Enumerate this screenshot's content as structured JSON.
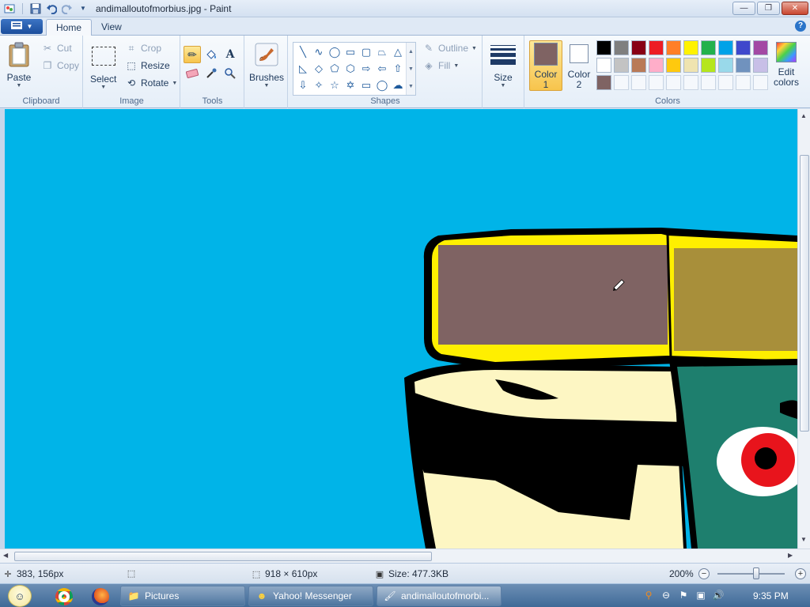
{
  "window": {
    "title": "andimalloutofmorbius.jpg - Paint",
    "minimize_glyph": "—",
    "restore_glyph": "❐",
    "close_glyph": "✕"
  },
  "ribbon_tabs": {
    "home": "Home",
    "view": "View",
    "help": "?"
  },
  "clipboard": {
    "paste": "Paste",
    "cut": "Cut",
    "copy": "Copy",
    "group_label": "Clipboard"
  },
  "image": {
    "select": "Select",
    "crop": "Crop",
    "resize": "Resize",
    "rotate": "Rotate",
    "group_label": "Image"
  },
  "tools": {
    "group_label": "Tools",
    "items": [
      "pencil-icon",
      "fill-icon",
      "text-icon",
      "eraser-icon",
      "color-picker-icon",
      "magnifier-icon"
    ],
    "text_glyph": "A"
  },
  "brushes": {
    "label": "Brushes"
  },
  "shapes": {
    "outline": "Outline",
    "fill": "Fill",
    "group_label": "Shapes"
  },
  "size": {
    "label": "Size"
  },
  "colors": {
    "color1_label": "Color 1",
    "color1_line1": "Color",
    "color1_line2": "1",
    "color2_line1": "Color",
    "color2_line2": "2",
    "edit_line1": "Edit",
    "edit_line2": "colors",
    "group_label": "Colors",
    "color1": "#7f6363",
    "color2": "#ffffff",
    "row1": [
      "#000000",
      "#7f7f7f",
      "#880015",
      "#ed1c24",
      "#ff7f27",
      "#fff200",
      "#22b14c",
      "#00a2e8",
      "#3f48cc",
      "#a349a4"
    ],
    "row2": [
      "#ffffff",
      "#c3c3c3",
      "#b97a57",
      "#ffaec9",
      "#ffc90e",
      "#efe4b0",
      "#b5e61d",
      "#99d9ea",
      "#7092be",
      "#c8bfe7"
    ],
    "row3": [
      "#7f6363"
    ]
  },
  "canvas": {
    "background": "#00b4e8"
  },
  "statusbar": {
    "cursor_pos": "383, 156px",
    "image_size": "918 × 610px",
    "file_size": "Size: 477.3KB",
    "zoom": "200%",
    "zoom_minus": "−",
    "zoom_plus": "+"
  },
  "taskbar": {
    "tasks": [
      "Pictures",
      "Yahoo! Messenger",
      "andimalloutofmorbi..."
    ],
    "clock": "9:35 PM"
  }
}
